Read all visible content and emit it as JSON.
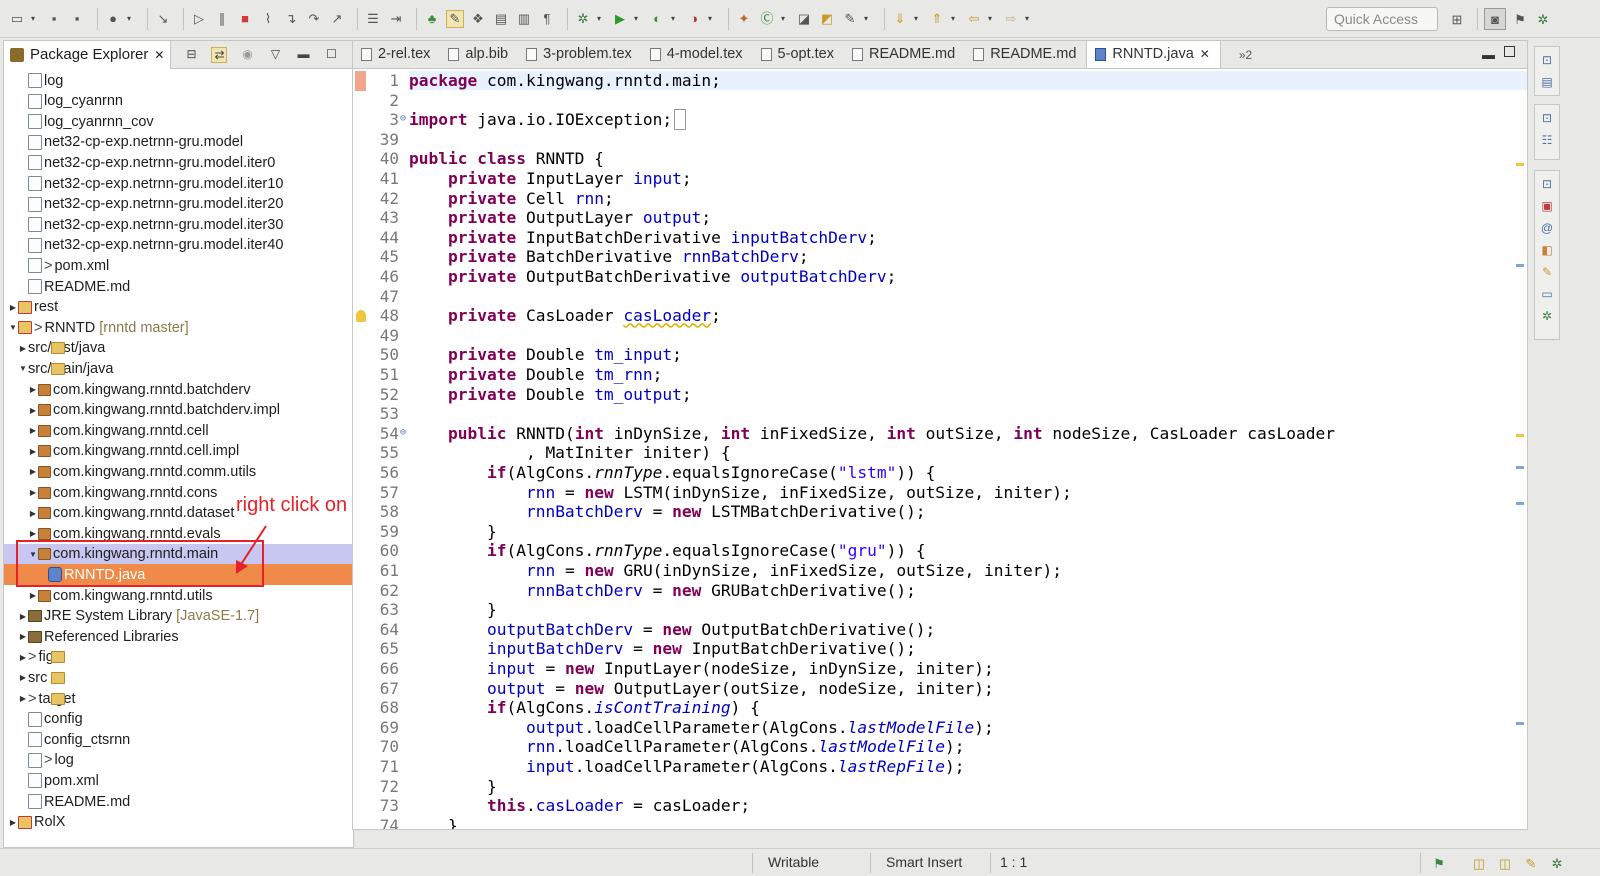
{
  "toolbar": {
    "quick_access": "Quick Access"
  },
  "package_explorer": {
    "title": "Package Explorer",
    "items": [
      {
        "label": "log",
        "icon": "file-icon",
        "indent": 1
      },
      {
        "label": "log_cyanrnn",
        "icon": "file-icon",
        "indent": 1
      },
      {
        "label": "log_cyanrnn_cov",
        "icon": "file-icon",
        "indent": 1
      },
      {
        "label": "net32-cp-exp.netrnn-gru.model",
        "icon": "file-icon",
        "indent": 1
      },
      {
        "label": "net32-cp-exp.netrnn-gru.model.iter0",
        "icon": "file-icon",
        "indent": 1
      },
      {
        "label": "net32-cp-exp.netrnn-gru.model.iter10",
        "icon": "file-icon",
        "indent": 1
      },
      {
        "label": "net32-cp-exp.netrnn-gru.model.iter20",
        "icon": "file-icon",
        "indent": 1
      },
      {
        "label": "net32-cp-exp.netrnn-gru.model.iter30",
        "icon": "file-icon",
        "indent": 1
      },
      {
        "label": "net32-cp-exp.netrnn-gru.model.iter40",
        "icon": "file-icon",
        "indent": 1
      },
      {
        "label": "pom.xml",
        "icon": "file-icon",
        "indent": 1,
        "changed": true
      },
      {
        "label": "README.md",
        "icon": "file-icon",
        "indent": 1
      },
      {
        "label": "rest",
        "icon": "project-icon",
        "indent": 0,
        "twisty": "closed"
      },
      {
        "label": "RNNTD",
        "icon": "project-icon",
        "indent": 0,
        "twisty": "open",
        "changed": true,
        "decoration": "[rnntd master]"
      },
      {
        "label": "src/test/java",
        "icon": "folder-icon",
        "indent": 1,
        "twisty": "closed"
      },
      {
        "label": "src/main/java",
        "icon": "folder-icon",
        "indent": 1,
        "twisty": "open"
      },
      {
        "label": "com.kingwang.rnntd.batchderv",
        "icon": "package-icon",
        "indent": 2,
        "twisty": "closed"
      },
      {
        "label": "com.kingwang.rnntd.batchderv.impl",
        "icon": "package-icon",
        "indent": 2,
        "twisty": "closed"
      },
      {
        "label": "com.kingwang.rnntd.cell",
        "icon": "package-icon",
        "indent": 2,
        "twisty": "closed"
      },
      {
        "label": "com.kingwang.rnntd.cell.impl",
        "icon": "package-icon",
        "indent": 2,
        "twisty": "closed"
      },
      {
        "label": "com.kingwang.rnntd.comm.utils",
        "icon": "package-icon",
        "indent": 2,
        "twisty": "closed"
      },
      {
        "label": "com.kingwang.rnntd.cons",
        "icon": "package-icon",
        "indent": 2,
        "twisty": "closed"
      },
      {
        "label": "com.kingwang.rnntd.dataset",
        "icon": "package-icon",
        "indent": 2,
        "twisty": "closed"
      },
      {
        "label": "com.kingwang.rnntd.evals",
        "icon": "package-icon",
        "indent": 2,
        "twisty": "closed"
      },
      {
        "label": "com.kingwang.rnntd.main",
        "icon": "package-icon",
        "indent": 2,
        "twisty": "open",
        "selected": true
      },
      {
        "label": "RNNTD.java",
        "icon": "java-file-icon",
        "indent": 3,
        "highlight": true
      },
      {
        "label": "com.kingwang.rnntd.utils",
        "icon": "package-icon",
        "indent": 2,
        "twisty": "closed"
      },
      {
        "label": "JRE System Library",
        "icon": "library-icon",
        "indent": 1,
        "twisty": "closed",
        "decoration": "[JavaSE-1.7]"
      },
      {
        "label": "Referenced Libraries",
        "icon": "library-icon",
        "indent": 1,
        "twisty": "closed"
      },
      {
        "label": "figs",
        "icon": "folder-icon",
        "indent": 1,
        "twisty": "closed",
        "changed": true
      },
      {
        "label": "src",
        "icon": "folder-icon",
        "indent": 1,
        "twisty": "closed"
      },
      {
        "label": "target",
        "icon": "folder-icon",
        "indent": 1,
        "twisty": "closed",
        "changed": true
      },
      {
        "label": "config",
        "icon": "file-icon",
        "indent": 1
      },
      {
        "label": "config_ctsrnn",
        "icon": "file-icon",
        "indent": 1
      },
      {
        "label": "log",
        "icon": "file-icon",
        "indent": 1,
        "changed": true
      },
      {
        "label": "pom.xml",
        "icon": "file-icon",
        "indent": 1
      },
      {
        "label": "README.md",
        "icon": "file-icon",
        "indent": 1
      },
      {
        "label": "RolX",
        "icon": "project-icon",
        "indent": 0,
        "twisty": "closed"
      }
    ],
    "annotation": "right click on the file with main class"
  },
  "editor": {
    "tabs": [
      {
        "label": "2-rel.tex"
      },
      {
        "label": "alp.bib"
      },
      {
        "label": "3-problem.tex"
      },
      {
        "label": "4-model.tex"
      },
      {
        "label": "5-opt.tex"
      },
      {
        "label": "README.md"
      },
      {
        "label": "README.md"
      },
      {
        "label": "RNNTD.java",
        "active": true
      }
    ],
    "more_tabs": "»2",
    "lines": [
      {
        "n": "1",
        "t": [
          [
            "kw",
            "package"
          ],
          [
            "",
            " com.kingwang.rnntd.main;"
          ]
        ],
        "cur": true
      },
      {
        "n": "2",
        "t": []
      },
      {
        "n": "3",
        "t": [
          [
            "kw",
            "import"
          ],
          [
            "",
            " java.io.IOException;"
          ]
        ],
        "fold": true
      },
      {
        "n": "39",
        "t": []
      },
      {
        "n": "40",
        "t": [
          [
            "kw",
            "public class"
          ],
          [
            "",
            " RNNTD {"
          ]
        ]
      },
      {
        "n": "41",
        "t": [
          [
            "",
            "    "
          ],
          [
            "kw",
            "private"
          ],
          [
            "",
            " InputLayer "
          ],
          [
            "fd",
            "input"
          ],
          [
            "",
            ";"
          ]
        ]
      },
      {
        "n": "42",
        "t": [
          [
            "",
            "    "
          ],
          [
            "kw",
            "private"
          ],
          [
            "",
            " Cell "
          ],
          [
            "fd",
            "rnn"
          ],
          [
            "",
            ";"
          ]
        ]
      },
      {
        "n": "43",
        "t": [
          [
            "",
            "    "
          ],
          [
            "kw",
            "private"
          ],
          [
            "",
            " OutputLayer "
          ],
          [
            "fd",
            "output"
          ],
          [
            "",
            ";"
          ]
        ]
      },
      {
        "n": "44",
        "t": [
          [
            "",
            "    "
          ],
          [
            "kw",
            "private"
          ],
          [
            "",
            " InputBatchDerivative "
          ],
          [
            "fd",
            "inputBatchDerv"
          ],
          [
            "",
            ";"
          ]
        ]
      },
      {
        "n": "45",
        "t": [
          [
            "",
            "    "
          ],
          [
            "kw",
            "private"
          ],
          [
            "",
            " BatchDerivative "
          ],
          [
            "fd",
            "rnnBatchDerv"
          ],
          [
            "",
            ";"
          ]
        ]
      },
      {
        "n": "46",
        "t": [
          [
            "",
            "    "
          ],
          [
            "kw",
            "private"
          ],
          [
            "",
            " OutputBatchDerivative "
          ],
          [
            "fd",
            "outputBatchDerv"
          ],
          [
            "",
            ";"
          ]
        ]
      },
      {
        "n": "47",
        "t": []
      },
      {
        "n": "48",
        "t": [
          [
            "",
            "    "
          ],
          [
            "kw",
            "private"
          ],
          [
            "",
            " CasLoader "
          ],
          [
            "fd warn",
            "casLoader"
          ],
          [
            "",
            ";"
          ]
        ],
        "bulb": true
      },
      {
        "n": "49",
        "t": []
      },
      {
        "n": "50",
        "t": [
          [
            "",
            "    "
          ],
          [
            "kw",
            "private"
          ],
          [
            "",
            " Double "
          ],
          [
            "fd",
            "tm_input"
          ],
          [
            "",
            ";"
          ]
        ]
      },
      {
        "n": "51",
        "t": [
          [
            "",
            "    "
          ],
          [
            "kw",
            "private"
          ],
          [
            "",
            " Double "
          ],
          [
            "fd",
            "tm_rnn"
          ],
          [
            "",
            ";"
          ]
        ]
      },
      {
        "n": "52",
        "t": [
          [
            "",
            "    "
          ],
          [
            "kw",
            "private"
          ],
          [
            "",
            " Double "
          ],
          [
            "fd",
            "tm_output"
          ],
          [
            "",
            ";"
          ]
        ]
      },
      {
        "n": "53",
        "t": []
      },
      {
        "n": "54",
        "t": [
          [
            "",
            "    "
          ],
          [
            "kw",
            "public"
          ],
          [
            "",
            " RNNTD("
          ],
          [
            "kw",
            "int"
          ],
          [
            "",
            " inDynSize, "
          ],
          [
            "kw",
            "int"
          ],
          [
            "",
            " inFixedSize, "
          ],
          [
            "kw",
            "int"
          ],
          [
            "",
            " outSize, "
          ],
          [
            "kw",
            "int"
          ],
          [
            "",
            " nodeSize, CasLoader casLoader"
          ]
        ],
        "fold": true
      },
      {
        "n": "55",
        "t": [
          [
            "",
            "            , MatIniter initer) {"
          ]
        ]
      },
      {
        "n": "56",
        "t": [
          [
            "",
            "        "
          ],
          [
            "kw",
            "if"
          ],
          [
            "",
            "(AlgCons."
          ],
          [
            "sm",
            "rnnType"
          ],
          [
            "",
            ".equalsIgnoreCase("
          ],
          [
            "st",
            "\"lstm\""
          ],
          [
            "",
            ")) {"
          ]
        ]
      },
      {
        "n": "57",
        "t": [
          [
            "",
            "            "
          ],
          [
            "fd",
            "rnn"
          ],
          [
            "",
            " = "
          ],
          [
            "kw",
            "new"
          ],
          [
            "",
            " LSTM(inDynSize, inFixedSize, outSize, initer);"
          ]
        ]
      },
      {
        "n": "58",
        "t": [
          [
            "",
            "            "
          ],
          [
            "fd",
            "rnnBatchDerv"
          ],
          [
            "",
            " = "
          ],
          [
            "kw",
            "new"
          ],
          [
            "",
            " LSTMBatchDerivative();"
          ]
        ]
      },
      {
        "n": "59",
        "t": [
          [
            "",
            "        }"
          ]
        ]
      },
      {
        "n": "60",
        "t": [
          [
            "",
            "        "
          ],
          [
            "kw",
            "if"
          ],
          [
            "",
            "(AlgCons."
          ],
          [
            "sm",
            "rnnType"
          ],
          [
            "",
            ".equalsIgnoreCase("
          ],
          [
            "st",
            "\"gru\""
          ],
          [
            "",
            ")) {"
          ]
        ]
      },
      {
        "n": "61",
        "t": [
          [
            "",
            "            "
          ],
          [
            "fd",
            "rnn"
          ],
          [
            "",
            " = "
          ],
          [
            "kw",
            "new"
          ],
          [
            "",
            " GRU(inDynSize, inFixedSize, outSize, initer);"
          ]
        ]
      },
      {
        "n": "62",
        "t": [
          [
            "",
            "            "
          ],
          [
            "fd",
            "rnnBatchDerv"
          ],
          [
            "",
            " = "
          ],
          [
            "kw",
            "new"
          ],
          [
            "",
            " GRUBatchDerivative();"
          ]
        ]
      },
      {
        "n": "63",
        "t": [
          [
            "",
            "        }"
          ]
        ]
      },
      {
        "n": "64",
        "t": [
          [
            "",
            "        "
          ],
          [
            "fd",
            "outputBatchDerv"
          ],
          [
            "",
            " = "
          ],
          [
            "kw",
            "new"
          ],
          [
            "",
            " OutputBatchDerivative();"
          ]
        ]
      },
      {
        "n": "65",
        "t": [
          [
            "",
            "        "
          ],
          [
            "fd",
            "inputBatchDerv"
          ],
          [
            "",
            " = "
          ],
          [
            "kw",
            "new"
          ],
          [
            "",
            " InputBatchDerivative();"
          ]
        ]
      },
      {
        "n": "66",
        "t": [
          [
            "",
            "        "
          ],
          [
            "fd",
            "input"
          ],
          [
            "",
            " = "
          ],
          [
            "kw",
            "new"
          ],
          [
            "",
            " InputLayer(nodeSize, inDynSize, initer);"
          ]
        ]
      },
      {
        "n": "67",
        "t": [
          [
            "",
            "        "
          ],
          [
            "fd",
            "output"
          ],
          [
            "",
            " = "
          ],
          [
            "kw",
            "new"
          ],
          [
            "",
            " OutputLayer(outSize, nodeSize, initer);"
          ]
        ]
      },
      {
        "n": "68",
        "t": [
          [
            "",
            "        "
          ],
          [
            "kw",
            "if"
          ],
          [
            "",
            "(AlgCons."
          ],
          [
            "sfd",
            "isContTraining"
          ],
          [
            "",
            ") {"
          ]
        ]
      },
      {
        "n": "69",
        "t": [
          [
            "",
            "            "
          ],
          [
            "fd",
            "output"
          ],
          [
            "",
            ".loadCellParameter(AlgCons."
          ],
          [
            "sfd",
            "lastModelFile"
          ],
          [
            "",
            ");"
          ]
        ]
      },
      {
        "n": "70",
        "t": [
          [
            "",
            "            "
          ],
          [
            "fd",
            "rnn"
          ],
          [
            "",
            ".loadCellParameter(AlgCons."
          ],
          [
            "sfd",
            "lastModelFile"
          ],
          [
            "",
            ");"
          ]
        ]
      },
      {
        "n": "71",
        "t": [
          [
            "",
            "            "
          ],
          [
            "fd",
            "input"
          ],
          [
            "",
            ".loadCellParameter(AlgCons."
          ],
          [
            "sfd",
            "lastRepFile"
          ],
          [
            "",
            ");"
          ]
        ]
      },
      {
        "n": "72",
        "t": [
          [
            "",
            "        }"
          ]
        ]
      },
      {
        "n": "73",
        "t": [
          [
            "",
            "        "
          ],
          [
            "kw",
            "this"
          ],
          [
            "",
            "."
          ],
          [
            "fd",
            "casLoader"
          ],
          [
            "",
            " = casLoader;"
          ]
        ]
      },
      {
        "n": "74",
        "t": [
          [
            "",
            "    }"
          ]
        ]
      }
    ]
  },
  "status": {
    "writable": "Writable",
    "insert_mode": "Smart Insert",
    "position": "1 : 1"
  },
  "colors": {
    "keyword": "#7f0055",
    "field": "#0000c0",
    "string": "#2a00ff",
    "selection": "#c7c7f2",
    "highlight": "#f08a49",
    "annotation": "#e8202a"
  }
}
